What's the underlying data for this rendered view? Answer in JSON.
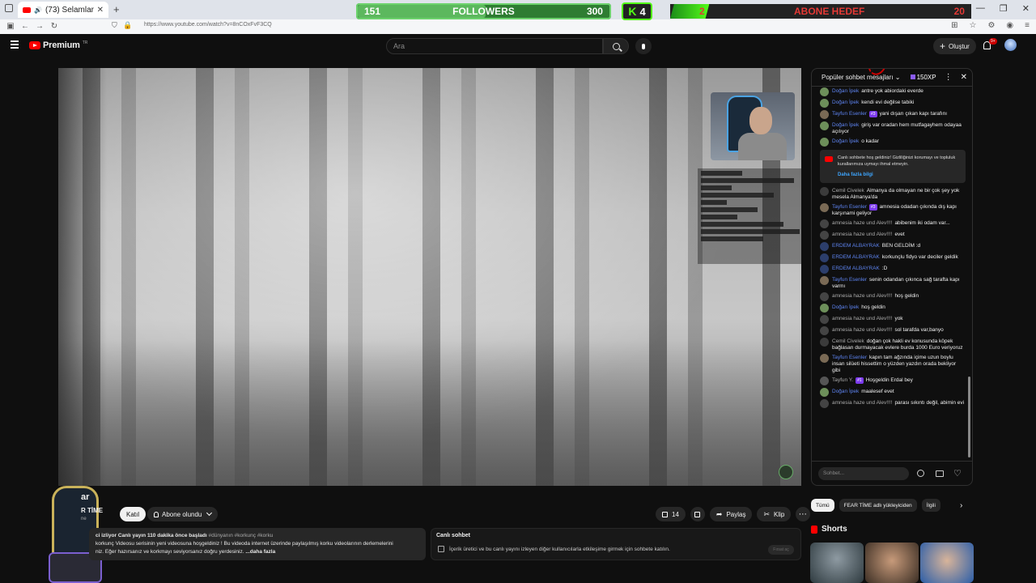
{
  "browser": {
    "tab_title": "(73) Selamlar - YouTube",
    "url": "https://www.youtube.com/watch?v=8nCOxFvF3CQ",
    "new_tab_label": "+"
  },
  "overlay": {
    "followers_label": "FOLLOWERS",
    "followers_current": "151",
    "followers_goal": "300",
    "followers_progress": 0.5,
    "kick_letter": "K",
    "kick_count": "4",
    "abone_label": "ABONE HEDEF",
    "abone_current": "2",
    "abone_goal": "20",
    "abone_progress": 0.1
  },
  "header": {
    "logo_text": "Premium",
    "logo_region": "TR",
    "search_placeholder": "Ara",
    "create_label": "Oluştur",
    "notif_badge": "9+"
  },
  "video": {
    "title": "ar",
    "channel_name": "R TİME",
    "channel_sub": "ne",
    "join_label": "Katıl",
    "subscribed_label": "Abone olundu",
    "likes": "14",
    "share_label": "Paylaş",
    "clip_label": "Klip"
  },
  "description": {
    "meta": "ci izliyor  Canlı yayın 110 dakika önce başladı",
    "tags": "#dünyanın #korkunç #korku",
    "line2": "korkunç Videosu serisinin yeni videosuna hoşgeldiniz ! Bu videoda internet üzerinde paylaşılmış korku videolarının derlemelerini",
    "line3": "niz. Eğer hazırsanız ve korkmayı seviyorsanız doğru yerdesiniz.",
    "more": "...daha fazla"
  },
  "livechat_card": {
    "title": "Canlı sohbet",
    "text": "İçerik üretici ve bu canlı yayını izleyen diğer kullanıcılarla etkileşime girmek için sohbete katılın.",
    "button": "Fırsat aç"
  },
  "chat": {
    "header": "Popüler sohbet mesajları",
    "xp": "150XP",
    "input_placeholder": "Sohbet...",
    "notice_text": "Canlı sohbete hoş geldiniz! Gizliliğinizi korumayı ve topluluk kurallarımıza uymayı ihmal etmeyin.",
    "notice_link": "Daha fazla bilgi",
    "messages": [
      {
        "name": "Doğan İpek",
        "badge": "",
        "text": "antre yok abiordaki everde",
        "type": "mod",
        "color": "#6d8f5a"
      },
      {
        "name": "Doğan İpek",
        "badge": "",
        "text": "kendi evi değilse tabiki",
        "type": "mod",
        "color": "#6d8f5a"
      },
      {
        "name": "Tayfun Esenler",
        "badge": "#3",
        "text": "yani dışarı çıkan kapı tarafını",
        "type": "mod",
        "color": "#7a6a55"
      },
      {
        "name": "Doğan İpek",
        "badge": "",
        "text": "giriş var oradan hem mutfagayhem odayaa açılıyor",
        "type": "mod",
        "color": "#6d8f5a"
      },
      {
        "name": "Doğan İpek",
        "badge": "",
        "text": "o kadar",
        "type": "mod",
        "color": "#6d8f5a"
      },
      {
        "name": "Cemil Civelek",
        "badge": "",
        "text": "Almanya da olmayan ne bir çok şey yok mesela Almanya'da",
        "type": "gray",
        "color": "#3b3b3b"
      },
      {
        "name": "Tayfun Esenler",
        "badge": "#3",
        "text": "amnesia odadan çıkında dış kapı karşınami geliyor",
        "type": "mod",
        "color": "#7a6a55"
      },
      {
        "name": "amnesia haze und Alev!!!!",
        "badge": "",
        "text": "abibenim iki odam var...",
        "type": "gray",
        "color": "#444"
      },
      {
        "name": "amnesia haze und Alev!!!!",
        "badge": "",
        "text": "evet",
        "type": "gray",
        "color": "#444"
      },
      {
        "name": "ERDEM ALBAYRAK",
        "badge": "",
        "text": "BEN GELDİM :d",
        "type": "mod",
        "color": "#2c3e6b"
      },
      {
        "name": "ERDEM ALBAYRAK",
        "badge": "",
        "text": "korkunçlu fidyo var deciler geldik",
        "type": "mod",
        "color": "#2c3e6b"
      },
      {
        "name": "ERDEM ALBAYRAK",
        "badge": "",
        "text": ":D",
        "type": "mod",
        "color": "#2c3e6b"
      },
      {
        "name": "Tayfun Esenler",
        "badge": "",
        "text": "senin odandan çıkınca sağ tarafta kapı varmı",
        "type": "mod",
        "color": "#7a6a55"
      },
      {
        "name": "amnesia haze und Alev!!!!",
        "badge": "",
        "text": "hoş geldin",
        "type": "gray",
        "color": "#444"
      },
      {
        "name": "Doğan İpek",
        "badge": "",
        "text": "hoş geldin",
        "type": "mod",
        "color": "#6d8f5a"
      },
      {
        "name": "amnesia haze und Alev!!!!",
        "badge": "",
        "text": "yok",
        "type": "gray",
        "color": "#444"
      },
      {
        "name": "amnesia haze und Alev!!!!",
        "badge": "",
        "text": "sol tarafda var,banyo",
        "type": "gray",
        "color": "#444"
      },
      {
        "name": "Cemil Civelek",
        "badge": "",
        "text": "doğan çok hakli ev konusunda köpek bağlasan durmayacak evlere burda 1000 Euro veriyoruz",
        "type": "gray",
        "color": "#3b3b3b"
      },
      {
        "name": "Tayfun Esenler",
        "badge": "",
        "text": "kapın tam ağzında içime uzun boylu insan silüeti hissettim o yüzden yazdın orada bekliyor gibi",
        "type": "mod",
        "color": "#7a6a55"
      },
      {
        "name": "Tayfun Y.",
        "badge": "#1",
        "text": "Hoşgeldin Erdal bey",
        "type": "gray",
        "color": "#555"
      },
      {
        "name": "Doğan İpek",
        "badge": "",
        "text": "maalesef evet",
        "type": "mod",
        "color": "#6d8f5a"
      },
      {
        "name": "amnesia haze und Alev!!!!",
        "badge": "",
        "text": "parası sıkıntı değil, abimin evi",
        "type": "gray",
        "color": "#444"
      }
    ]
  },
  "recommend": {
    "chips": [
      "Tümü",
      "FEAR TİME adlı yükleyiciden",
      "İlgili"
    ],
    "shorts_title": "Shorts"
  }
}
